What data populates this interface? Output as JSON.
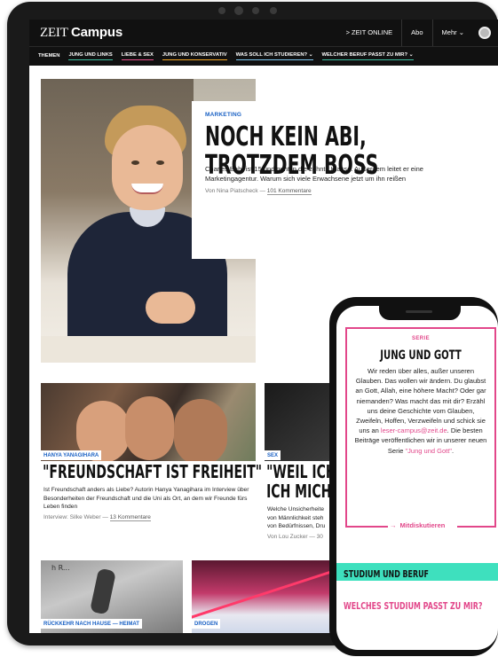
{
  "tablet": {
    "topbar": {
      "logo_main": "ZEIT",
      "logo_sub": "Campus",
      "items": [
        "> ZEIT ONLINE",
        "Abo",
        "Mehr ⌄"
      ]
    },
    "nav": {
      "items": [
        "THEMEN",
        "JUNG UND LINKS",
        "LIEBE & SEX",
        "JUNG UND KONSERVATIV",
        "WAS SOLL ICH STUDIEREN? ⌄",
        "WELCHER BERUF PASST ZU MIR? ⌄"
      ]
    },
    "hero": {
      "kicker": "MARKETING",
      "title": "NOCH KEIN ABI, TROTZDEM BOSS",
      "description": "Charles Bahr ist 15 und geht in die zehnte Klasse. Außerdem leitet er eine Marketingagentur. Warum sich viele Erwachsene jetzt um ihn reißen",
      "author": "Von Nina Piatscheck",
      "separator": "—",
      "comments": "101 Kommentare"
    },
    "article2": {
      "label": "HANYA YANAGIHARA",
      "title": "\"FREUNDSCHAFT IST FREIHEIT\"",
      "description": "Ist Freundschaft anders als Liebe? Autorin Hanya Yanagihara im Interview über Besonderheiten der Freundschaft und die Uni als Ort, an dem wir Freunde fürs Leben finden",
      "author": "Interview: Silke Weber",
      "separator": "—",
      "comments": "13 Kommentare"
    },
    "article3": {
      "label": "SEX",
      "title_line1": "\"WEIL ICH SC",
      "title_line2": "ICH MICH SC",
      "desc_line1": "Welche Unsicherheite",
      "desc_line2": "von Männlichkeit steh",
      "desc_line3": "von Bedürfnissen, Dru",
      "author": "Von Lou Zucker",
      "separator": "—",
      "comments_cut": "30"
    },
    "article4": {
      "label": "RÜCKKEHR NACH HAUSE",
      "separator": "—",
      "sublabel": "HEIMAT",
      "photo_text": "h R..."
    },
    "article5": {
      "label": "DROGEN"
    }
  },
  "phone": {
    "serie": "SERIE",
    "title": "JUNG UND GOTT",
    "body_before": "Wir reden über alles, außer unseren Glauben. Das wollen wir ändern. Du glaubst an Gott, Allah, eine höhere Macht? Oder gar niemanden? Was macht das mit dir? Erzähl uns deine Geschichte vom Glauben, Zweifeln, Hoffen, Verzweifeln und schick sie uns an ",
    "email": "leser-campus@zeit.de",
    "body_middle": ". Die besten Beiträge veröffentlichen wir in unserer neuen Serie ",
    "series_link": "\"Jung und Gott\"",
    "body_end": ".",
    "cta": "Mitdiskutieren",
    "band_title": "STUDIUM UND BERUF",
    "question": "WELCHES STUDIUM PASST ZU MIR?"
  },
  "colors": {
    "accent_blue": "#1a61c4",
    "accent_pink": "#e2478a",
    "accent_teal": "#3ee0be",
    "topbar_bg": "#111111"
  }
}
